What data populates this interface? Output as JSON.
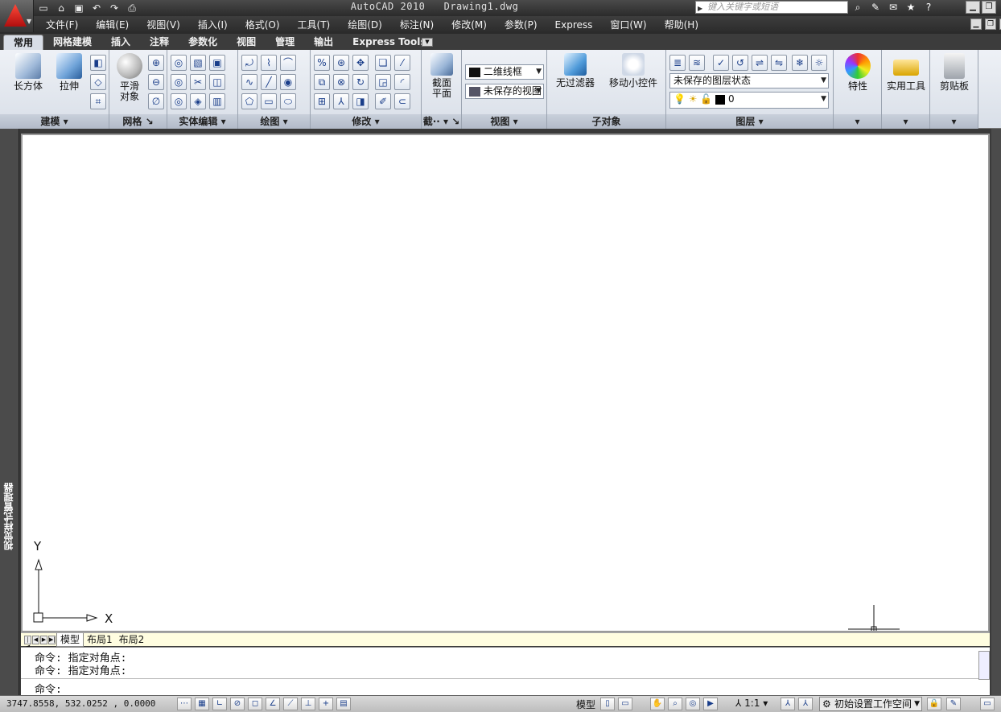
{
  "title": {
    "app_name": "AutoCAD 2010",
    "document": "Drawing1.dwg"
  },
  "search": {
    "placeholder": "键入关键字或短语"
  },
  "menu": [
    {
      "label": "文件(F)"
    },
    {
      "label": "编辑(E)"
    },
    {
      "label": "视图(V)"
    },
    {
      "label": "插入(I)"
    },
    {
      "label": "格式(O)"
    },
    {
      "label": "工具(T)"
    },
    {
      "label": "绘图(D)"
    },
    {
      "label": "标注(N)"
    },
    {
      "label": "修改(M)"
    },
    {
      "label": "参数(P)"
    },
    {
      "label": "Express"
    },
    {
      "label": "窗口(W)"
    },
    {
      "label": "帮助(H)"
    }
  ],
  "tabs": [
    {
      "label": "常用",
      "active": true
    },
    {
      "label": "网格建模"
    },
    {
      "label": "插入"
    },
    {
      "label": "注释"
    },
    {
      "label": "参数化"
    },
    {
      "label": "视图"
    },
    {
      "label": "管理"
    },
    {
      "label": "输出"
    },
    {
      "label": "Express Tools"
    }
  ],
  "ribbon": {
    "panels": {
      "modeling": "建模",
      "mesh": "网格",
      "solid_edit": "实体编辑",
      "draw": "绘图",
      "modify": "修改",
      "section": "截··",
      "view": "视图",
      "subobject": "子对象",
      "layers": "图层"
    },
    "buttons": {
      "box": "长方体",
      "extrude": "拉伸",
      "smooth1": "平滑",
      "smooth2": "对象",
      "section1": "截面",
      "section2": "平面",
      "no_filter": "无过滤器",
      "gizmo": "移动小控件",
      "properties": "特性",
      "utilities": "实用工具",
      "clipboard": "剪贴板"
    },
    "combos": {
      "visual_style": "二维线框",
      "saved_view": "未保存的视图",
      "layer_state": "未保存的图层状态",
      "current_layer": "0"
    }
  },
  "left_palette": "视觉样式管理器",
  "layout_tabs": [
    {
      "label": "模型"
    },
    {
      "label": "布局1"
    },
    {
      "label": "布局2"
    }
  ],
  "ucs": {
    "x": "X",
    "y": "Y"
  },
  "command": {
    "history": [
      "命令: 指定对角点:",
      "命令: 指定对角点:"
    ],
    "prompt": "命令:"
  },
  "status": {
    "coords": "3747.8558, 532.0252 , 0.0000",
    "model": "模型",
    "scale": "1:1",
    "workspace": "初始设置工作空间"
  }
}
